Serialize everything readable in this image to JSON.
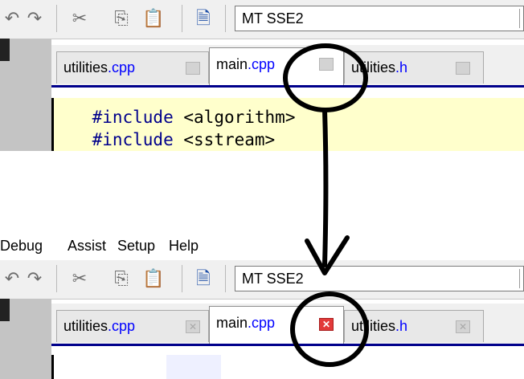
{
  "top": {
    "toolbar": {
      "config_value": "MT SSE2"
    },
    "tabs": [
      {
        "name": "utilities",
        "ext": ".cpp",
        "close": "none"
      },
      {
        "name": "main",
        "ext": ".cpp",
        "close": "none"
      },
      {
        "name": "utilities",
        "ext": ".h",
        "close": "none"
      }
    ],
    "code_lines": [
      {
        "directive": "#include",
        "arg": "<algorithm>"
      },
      {
        "directive": "#include",
        "arg": "<sstream>"
      }
    ]
  },
  "bottom": {
    "menu": [
      "Debug",
      "Assist",
      "Setup",
      "Help"
    ],
    "toolbar": {
      "config_value": "MT SSE2"
    },
    "tabs": [
      {
        "name": "utilities",
        "ext": ".cpp",
        "close": "gray"
      },
      {
        "name": "main",
        "ext": ".cpp",
        "close": "red"
      },
      {
        "name": "utilities",
        "ext": ".h",
        "close": "gray"
      }
    ]
  },
  "icons": [
    "undo-icon",
    "redo-icon",
    "cut-icon",
    "copy-icon",
    "paste-icon",
    "new-file-icon",
    "close-tab-icon"
  ],
  "colors": {
    "tab_ext": "#0000ff",
    "close_active": "#e23a3a",
    "editor_bg": "#ffffcc",
    "tab_underline": "#00008b"
  }
}
